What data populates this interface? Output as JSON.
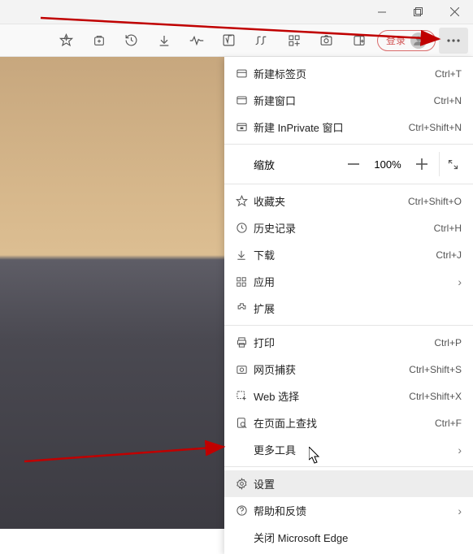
{
  "window": {
    "login_label": "登录"
  },
  "menu": {
    "new_tab": {
      "label": "新建标签页",
      "shortcut": "Ctrl+T"
    },
    "new_window": {
      "label": "新建窗口",
      "shortcut": "Ctrl+N"
    },
    "new_inprivate": {
      "label": "新建 InPrivate 窗口",
      "shortcut": "Ctrl+Shift+N"
    },
    "zoom": {
      "label": "缩放",
      "value": "100%"
    },
    "favorites": {
      "label": "收藏夹",
      "shortcut": "Ctrl+Shift+O"
    },
    "history": {
      "label": "历史记录",
      "shortcut": "Ctrl+H"
    },
    "downloads": {
      "label": "下载",
      "shortcut": "Ctrl+J"
    },
    "apps": {
      "label": "应用"
    },
    "extensions": {
      "label": "扩展"
    },
    "print": {
      "label": "打印",
      "shortcut": "Ctrl+P"
    },
    "web_capture": {
      "label": "网页捕获",
      "shortcut": "Ctrl+Shift+S"
    },
    "web_select": {
      "label": "Web 选择",
      "shortcut": "Ctrl+Shift+X"
    },
    "find": {
      "label": "在页面上查找",
      "shortcut": "Ctrl+F"
    },
    "more_tools": {
      "label": "更多工具"
    },
    "settings": {
      "label": "设置"
    },
    "help": {
      "label": "帮助和反馈"
    },
    "close": {
      "label": "关闭 Microsoft Edge"
    }
  }
}
